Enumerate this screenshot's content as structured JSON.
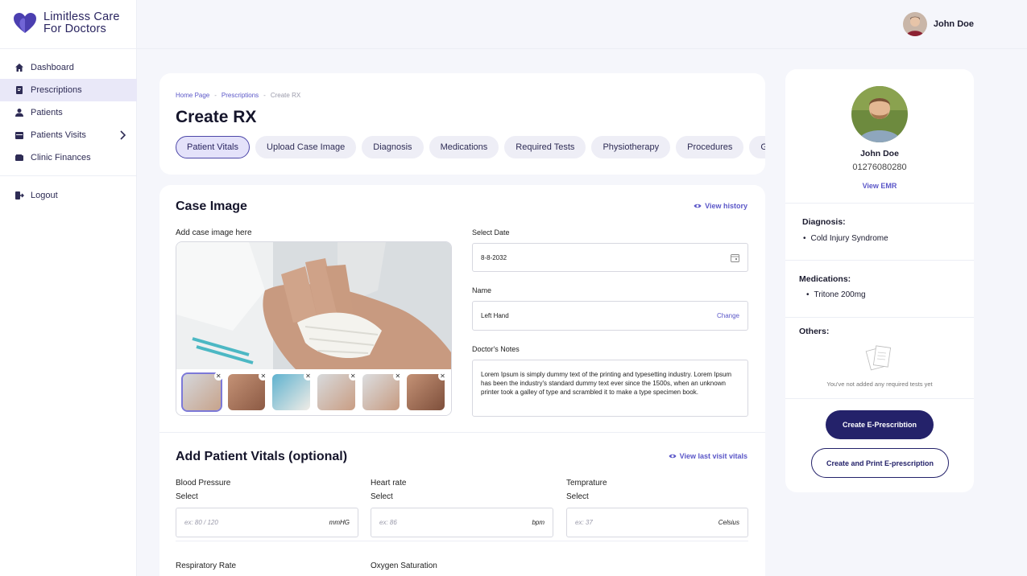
{
  "brand": {
    "line1": "Limitless Care",
    "line2": "For Doctors"
  },
  "sidebar": {
    "items": [
      {
        "label": "Dashboard",
        "icon": "home-icon"
      },
      {
        "label": "Prescriptions",
        "icon": "prescription-icon",
        "active": true
      },
      {
        "label": "Patients",
        "icon": "patient-icon"
      },
      {
        "label": "Patients Visits",
        "icon": "calendar-icon",
        "has_submenu": true
      },
      {
        "label": "Clinic Finances",
        "icon": "wallet-icon"
      }
    ],
    "logout": "Logout"
  },
  "topbar": {
    "user_name": "John Doe"
  },
  "breadcrumb": [
    "Home Page",
    "Prescriptions",
    "Create RX"
  ],
  "page_title": "Create RX",
  "tabs": [
    "Patient Vitals",
    "Upload Case Image",
    "Diagnosis",
    "Medications",
    "Required Tests",
    "Physiotherapy",
    "Procedures",
    "General"
  ],
  "case_image": {
    "title": "Case Image",
    "view_history": "View history",
    "add_label": "Add case image here",
    "select_date_label": "Select Date",
    "date_value": "8-8-2032",
    "name_label": "Name",
    "name_value": "Left Hand",
    "change_link": "Change",
    "notes_label": "Doctor's Notes",
    "notes_value": "Lorem Ipsum is simply dummy text of the printing and typesetting industry. Lorem Ipsum has been the industry's standard dummy text ever since the 1500s, when an unknown printer took a galley of type and scrambled it to make a type specimen book."
  },
  "vitals": {
    "title": "Add Patient Vitals (optional)",
    "view_last": "View last visit vitals",
    "fields": [
      {
        "label": "Blood Pressure",
        "sub": "Select",
        "placeholder": "ex: 80 / 120",
        "unit": "mmHG"
      },
      {
        "label": "Heart rate",
        "sub": "Select",
        "placeholder": "ex: 86",
        "unit": "bpm"
      },
      {
        "label": "Temprature",
        "sub": "Select",
        "placeholder": "ex: 37",
        "unit": "Celsius"
      }
    ],
    "more_labels": [
      "Respiratory Rate",
      "Oxygen Saturation"
    ]
  },
  "patient": {
    "name": "John Doe",
    "phone": "01276080280",
    "view_emr": "View EMR",
    "diagnosis_title": "Diagnosis:",
    "diagnosis_items": [
      "Cold Injury Syndrome"
    ],
    "medications_title": "Medications:",
    "medication_items": [
      "Tritone 200mg"
    ],
    "others_title": "Others:",
    "others_empty": "You've not added any required tests yet",
    "btn_create": "Create E-Prescribtion",
    "btn_print": "Create and Print E-prescription"
  },
  "colors": {
    "accent": "#5b57c8",
    "primary_dark": "#24226a",
    "active_bg": "#e9e8f8"
  }
}
